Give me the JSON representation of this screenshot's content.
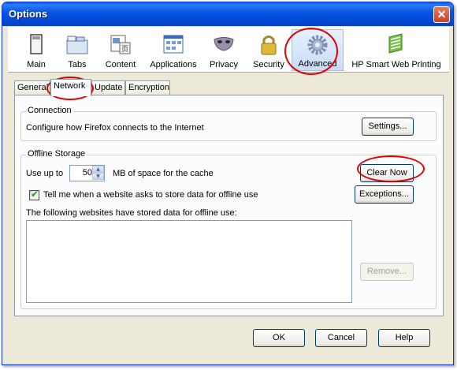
{
  "window": {
    "title": "Options",
    "close_glyph": "✕"
  },
  "toolbar": {
    "items": [
      {
        "label": "Main",
        "icon": "main-window-icon"
      },
      {
        "label": "Tabs",
        "icon": "tabs-icon"
      },
      {
        "label": "Content",
        "icon": "content-icon"
      },
      {
        "label": "Applications",
        "icon": "applications-icon"
      },
      {
        "label": "Privacy",
        "icon": "privacy-mask-icon"
      },
      {
        "label": "Security",
        "icon": "security-lock-icon"
      },
      {
        "label": "Advanced",
        "icon": "advanced-gear-icon",
        "selected": true
      },
      {
        "label": "HP Smart Web Printing",
        "icon": "hp-smart-web-printing-icon"
      }
    ]
  },
  "tabs": [
    {
      "label": "General"
    },
    {
      "label": "Network",
      "active": true
    },
    {
      "label": "Update"
    },
    {
      "label": "Encryption"
    }
  ],
  "connection": {
    "caption": "Connection",
    "description": "Configure how Firefox connects to the Internet",
    "settings_button": "Settings..."
  },
  "offline": {
    "caption": "Offline Storage",
    "use_up_to_label": "Use up to",
    "cache_value": "50",
    "cache_suffix": "MB of space for the cache",
    "clear_now_button": "Clear Now",
    "tell_me_label": "Tell me when a website asks to store data for offline use",
    "tell_me_checked": true,
    "exceptions_button": "Exceptions...",
    "list_label": "The following websites have stored data for offline use:",
    "remove_button": "Remove..."
  },
  "footer": {
    "ok_button": "OK",
    "cancel_button": "Cancel",
    "help_button": "Help"
  },
  "colors": {
    "annotation": "#e00000",
    "titlebar": "#0054e3",
    "dialog_bg": "#ece9d8"
  }
}
